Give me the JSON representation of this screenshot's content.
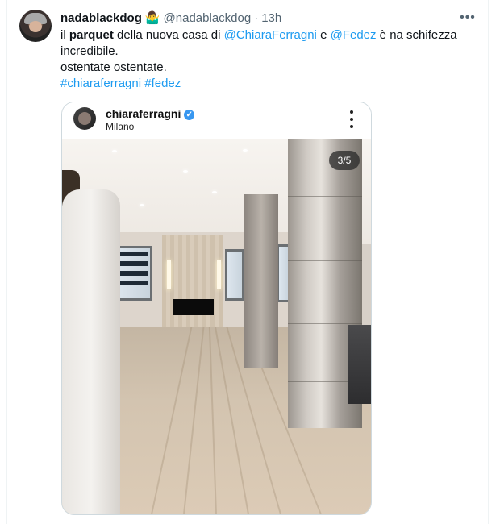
{
  "tweet": {
    "display_name": "nadablackdog",
    "name_emoji": "🤷‍♂️",
    "handle": "@nadablackdog",
    "separator": "·",
    "time": "13h",
    "more_icon": "more-horizontal-icon",
    "text": {
      "w1": "il ",
      "w2": "parquet",
      "w3": " della nuova casa di ",
      "m1": "@ChiaraFerragni",
      "w4": " e ",
      "m2": "@Fedez",
      "w5": " è na schifezza incredibile.",
      "line2": "ostentate ostentate.",
      "h1": "#chiaraferragni",
      "h2": "#fedez"
    }
  },
  "embed": {
    "account": "chiaraferragni",
    "verified_icon": "verified-badge-icon",
    "location": "Milano",
    "more_icon": "more-vertical-icon",
    "carousel_counter": "3/5"
  },
  "colors": {
    "link": "#1d9bf0",
    "muted": "#536471",
    "border": "#cfd9de"
  }
}
